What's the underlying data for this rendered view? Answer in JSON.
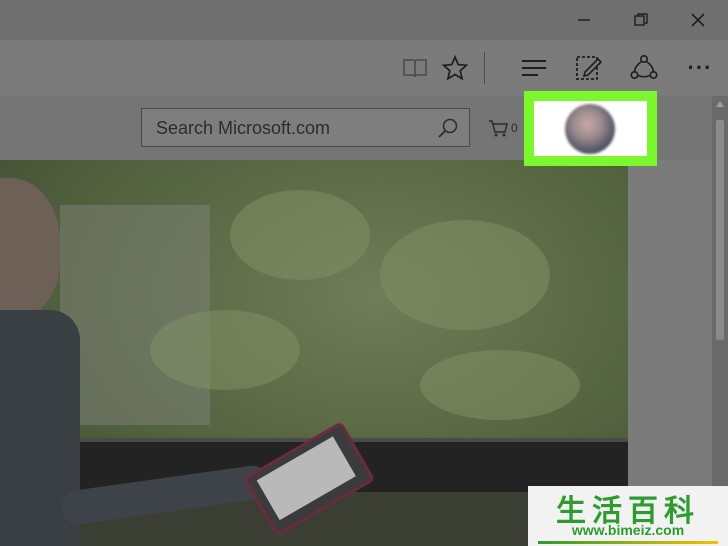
{
  "titlebar": {
    "buttons": [
      "minimize-icon",
      "restore-icon",
      "close-icon"
    ]
  },
  "toolbar": {
    "icons": [
      "reading-view-icon",
      "favorite-star-icon",
      "hub-icon",
      "web-note-icon",
      "share-icon",
      "more-icon"
    ],
    "more_label": "···"
  },
  "header": {
    "search": {
      "placeholder": "Search Microsoft.com"
    },
    "cart": {
      "count": "0"
    }
  },
  "highlight": {
    "color": "#7cf72e"
  },
  "watermark": {
    "title": "生活百科",
    "url": "www.bimeiz.com"
  }
}
